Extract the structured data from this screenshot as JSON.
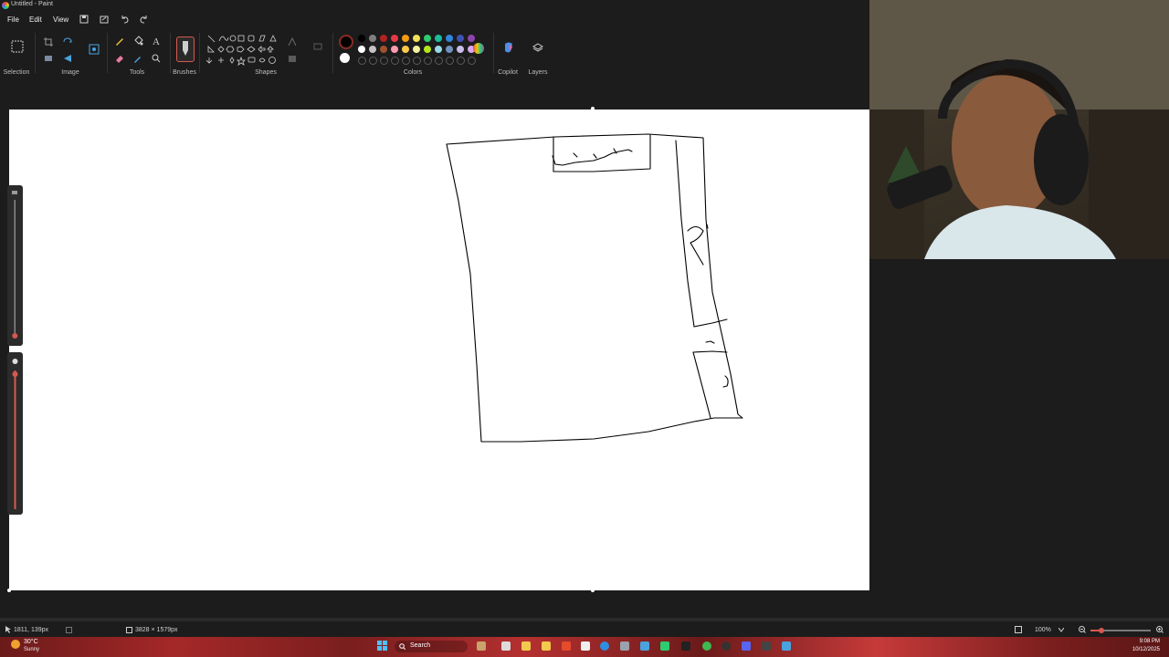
{
  "window": {
    "title": "Untitled - Paint"
  },
  "menu": {
    "file": "File",
    "edit": "Edit",
    "view": "View"
  },
  "ribbon": {
    "groups": {
      "selection": "Selection",
      "image": "Image",
      "tools": "Tools",
      "brushes": "Brushes",
      "shapes": "Shapes",
      "colors": "Colors",
      "copilot": "Copilot",
      "layers": "Layers"
    },
    "palette_row1": [
      "#000000",
      "#7f7f7f",
      "#b22222",
      "#e63946",
      "#f39c12",
      "#f1e05a",
      "#2ecc71",
      "#1abc9c",
      "#2e86de",
      "#3f51b5",
      "#8e44ad"
    ],
    "palette_row2": [
      "#ffffff",
      "#c3c3c3",
      "#a0522d",
      "#ff9ab0",
      "#ffc94a",
      "#f5f3a0",
      "#b5e61d",
      "#99d9ea",
      "#7092be",
      "#c8bfe7",
      "#d7a8f0"
    ],
    "primary_color": "#000000",
    "secondary_color": "#ffffff"
  },
  "status": {
    "cursor_pos": "1811, 139px",
    "canvas_size": "3828 × 1579px",
    "zoom": "100%"
  },
  "taskbar": {
    "weather_temp": "30°C",
    "weather_desc": "Sunny",
    "search_label": "Search",
    "time": "9:08 PM",
    "date": "10/12/2025"
  },
  "colors": {
    "accent": "#d8584f",
    "background": "#1c1c1c",
    "canvas": "#ffffff"
  }
}
